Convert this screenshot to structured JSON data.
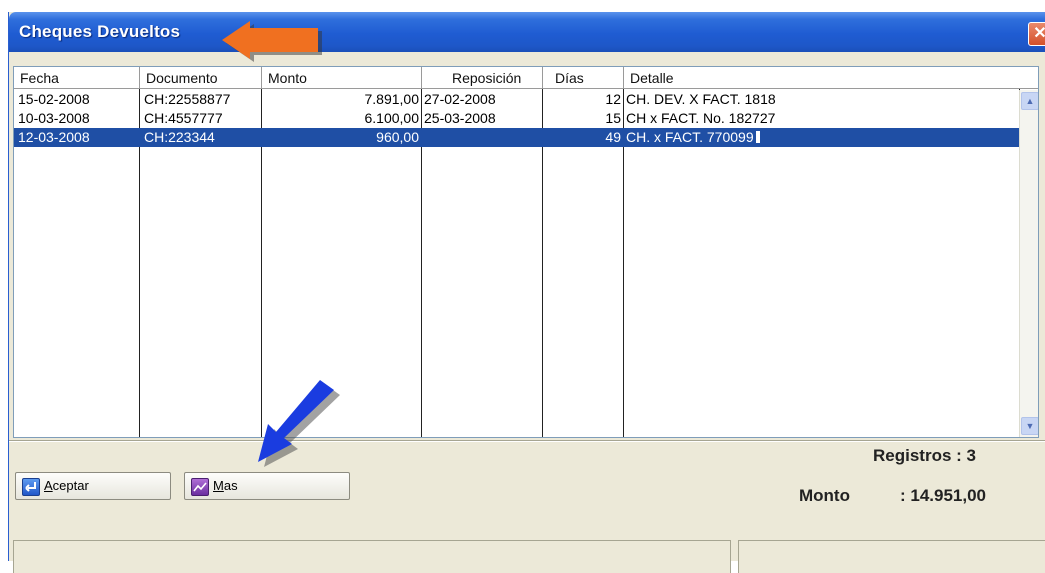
{
  "window": {
    "title": "Cheques Devueltos",
    "close_glyph": "✕"
  },
  "grid": {
    "columns": [
      "Fecha",
      "Documento",
      "Monto",
      "Reposición",
      "Días",
      "Detalle"
    ],
    "rows": [
      [
        "15-02-2008",
        "CH:22558877",
        "7.891,00",
        "27-02-2008",
        "12",
        "CH. DEV. X FACT. 1818"
      ],
      [
        "10-03-2008",
        "CH:4557777",
        "6.100,00",
        "25-03-2008",
        "15",
        "CH x FACT. No. 182727"
      ],
      [
        "12-03-2008",
        "CH:223344",
        "960,00",
        "",
        "49",
        "CH. x FACT. 770099"
      ]
    ],
    "selected_row": 2
  },
  "buttons": {
    "aceptar": {
      "label_first": "A",
      "label_rest": "ceptar"
    },
    "mas": {
      "label_first": "M",
      "label_rest": "as"
    }
  },
  "summary": {
    "registros_label": "Registros : 3",
    "monto_label": "Monto",
    "monto_value": ": 14.951,00"
  },
  "colors": {
    "selection": "#1f4fa5",
    "title_bar": "#1f5cd2",
    "orange_arrow": "#f07020",
    "blue_arrow": "#1a3ce0"
  },
  "icons": {
    "aceptar": "enter-icon",
    "mas": "chart-icon",
    "close": "close-icon"
  }
}
